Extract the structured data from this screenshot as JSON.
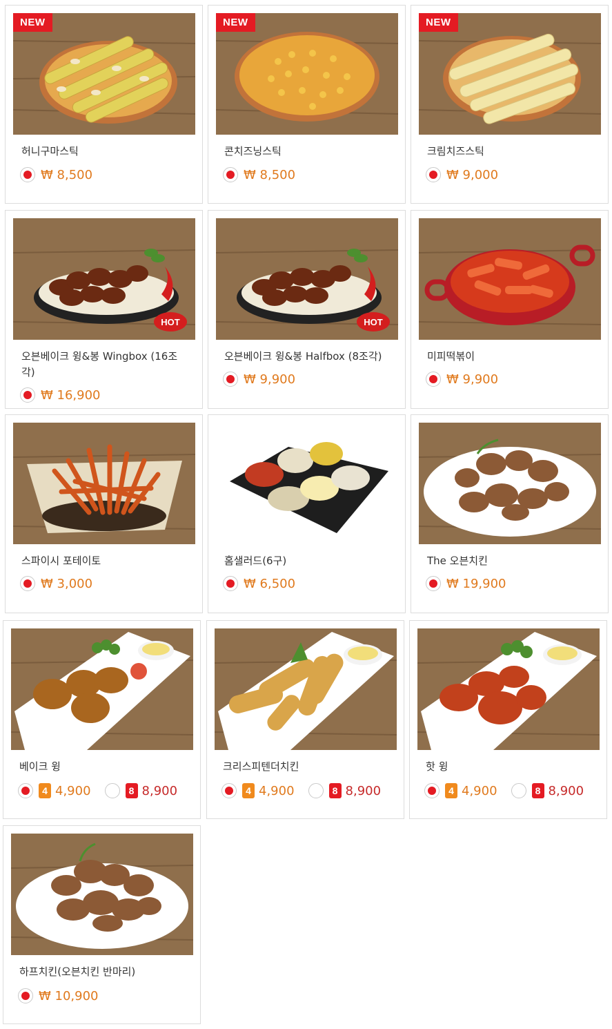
{
  "currency": "₩",
  "badges": {
    "new": "NEW",
    "hot": "HOT"
  },
  "colors": {
    "accent_red": "#e41b23",
    "price_orange": "#e07a1e",
    "wood": "#8a6a4a"
  },
  "items": [
    {
      "name": "허니구마스틱",
      "new": true,
      "price": "₩ 8,500",
      "image": "honey-sweet-potato-stick-pizza"
    },
    {
      "name": "콘치즈닝스틱",
      "new": true,
      "price": "₩ 8,500",
      "image": "corn-cheese-stick-pizza"
    },
    {
      "name": "크림치즈스틱",
      "new": true,
      "price": "₩ 9,000",
      "image": "cream-cheese-stick-pizza"
    },
    {
      "name": "오븐베이크 윙&봉 Wingbox (16조각)",
      "price": "₩ 16,900",
      "image": "baked-wings-hot"
    },
    {
      "name": "오븐베이크 윙&봉 Halfbox (8조각)",
      "price": "₩ 9,900",
      "image": "baked-wings-hot"
    },
    {
      "name": "미피떡볶이",
      "price": "₩ 9,900",
      "image": "tteokbokki-pan"
    },
    {
      "name": "스파이시 포테이토",
      "price": "₩ 3,000",
      "image": "spicy-fries"
    },
    {
      "name": "홈샐러드(6구)",
      "price": "₩ 6,500",
      "image": "salad-box"
    },
    {
      "name": "The 오븐치킨",
      "price": "₩ 19,900",
      "image": "oven-chicken-plate"
    },
    {
      "name": "베이크 윙",
      "size_a": "4",
      "price_a": "4,900",
      "size_b": "8",
      "price_b": "8,900",
      "image": "bake-wing-plate"
    },
    {
      "name": "크리스피텐더치킨",
      "size_a": "4",
      "price_a": "4,900",
      "size_b": "8",
      "price_b": "8,900",
      "image": "crispy-tender-plate"
    },
    {
      "name": "핫 윙",
      "size_a": "4",
      "price_a": "4,900",
      "size_b": "8",
      "price_b": "8,900",
      "image": "hot-wing-plate"
    },
    {
      "name": "하프치킨(오븐치킨 반마리)",
      "price": "₩ 10,900",
      "image": "half-chicken-plate"
    }
  ]
}
